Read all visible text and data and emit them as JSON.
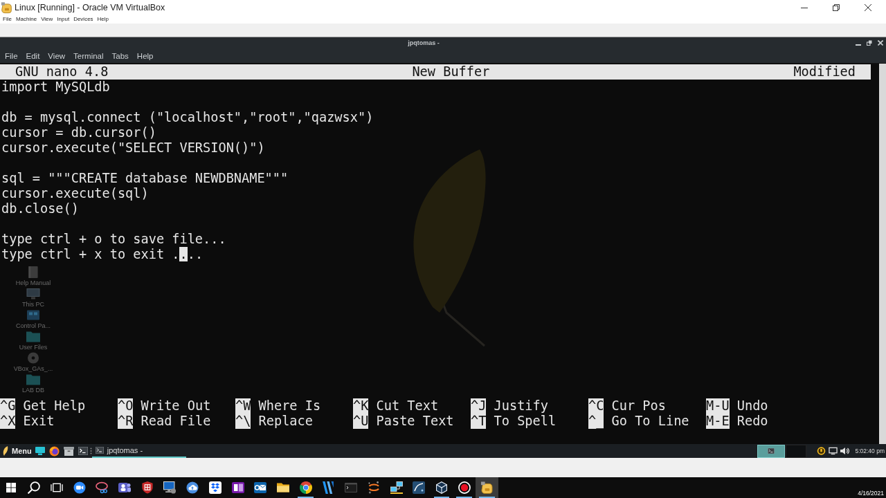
{
  "vbox_window": {
    "title": "Linux [Running] - Oracle VM VirtualBox",
    "menu": [
      "File",
      "Machine",
      "View",
      "Input",
      "Devices",
      "Help"
    ]
  },
  "terminal": {
    "title": "jpqtomas -",
    "menu": [
      "File",
      "Edit",
      "View",
      "Terminal",
      "Tabs",
      "Help"
    ]
  },
  "nano": {
    "version": "GNU nano 4.8",
    "buffer": "New Buffer",
    "status": "Modified",
    "blocks": [
      [
        {
          "text": "import MySQLdb"
        }
      ],
      [
        {
          "text": "db = mysql.connect (\"localhost\",\"root\",\"qazwsx\")"
        },
        {
          "text": "cursor = db.cursor()"
        },
        {
          "text": "cursor.execute(\"SELECT VERSION()\")"
        }
      ],
      [
        {
          "text": "sql = \"\"\"CREATE database NEWDBNAME\"\"\""
        },
        {
          "text": "cursor.execute(sql)"
        },
        {
          "text": "db.close()"
        }
      ],
      [
        {
          "text": "type ctrl + o to save file..."
        },
        {
          "text": "type ctrl + x to exit .",
          "cursor": ".",
          "after": ".."
        }
      ]
    ],
    "shortcut_rows": [
      [
        {
          "key": "^G",
          "label": "Get Help"
        },
        {
          "key": "^O",
          "label": "Write Out"
        },
        {
          "key": "^W",
          "label": "Where Is"
        },
        {
          "key": "^K",
          "label": "Cut Text"
        },
        {
          "key": "^J",
          "label": "Justify"
        },
        {
          "key": "^C",
          "label": "Cur Pos"
        },
        {
          "key": "M-U",
          "label": "Undo"
        }
      ],
      [
        {
          "key": "^X",
          "label": "Exit"
        },
        {
          "key": "^R",
          "label": "Read File"
        },
        {
          "key": "^\\",
          "label": "Replace"
        },
        {
          "key": "^U",
          "label": "Paste Text"
        },
        {
          "key": "^T",
          "label": "To Spell"
        },
        {
          "key": "^_",
          "label": "Go To Line"
        },
        {
          "key": "M-E",
          "label": "Redo"
        }
      ]
    ]
  },
  "desktop_icons": [
    {
      "label": "Help Manual"
    },
    {
      "label": "This PC"
    },
    {
      "label": "Control Pa..."
    },
    {
      "label": "User Files"
    },
    {
      "label": "VBox_GAs_..."
    },
    {
      "label": "LAB DB"
    }
  ],
  "linux_panel": {
    "menu": "Menu",
    "windows": [
      {
        "title": "jpqtomas -",
        "selected": true
      }
    ],
    "workspaces": [
      {
        "selected": true
      },
      {
        "selected": false
      }
    ],
    "clock": "5:02:40 pm"
  },
  "windows_taskbar": {
    "apps": [
      {
        "running": false,
        "selected": false
      },
      {
        "running": false,
        "selected": false
      },
      {
        "running": false,
        "selected": false
      },
      {
        "running": false,
        "selected": false
      },
      {
        "running": false,
        "selected": false
      },
      {
        "running": false,
        "selected": false
      },
      {
        "running": false,
        "selected": false
      },
      {
        "running": false,
        "selected": false
      },
      {
        "running": false,
        "selected": false
      },
      {
        "running": false,
        "selected": false
      },
      {
        "running": false,
        "selected": false
      },
      {
        "running": false,
        "selected": false
      },
      {
        "running": false,
        "selected": false
      },
      {
        "running": true,
        "selected": false
      },
      {
        "running": false,
        "selected": false
      },
      {
        "running": false,
        "selected": false
      },
      {
        "running": false,
        "selected": false
      },
      {
        "running": false,
        "selected": false
      },
      {
        "running": false,
        "selected": false
      },
      {
        "running": true,
        "selected": false
      },
      {
        "running": true,
        "selected": false
      },
      {
        "running": true,
        "selected": true
      }
    ],
    "date": "4/16/2021"
  }
}
